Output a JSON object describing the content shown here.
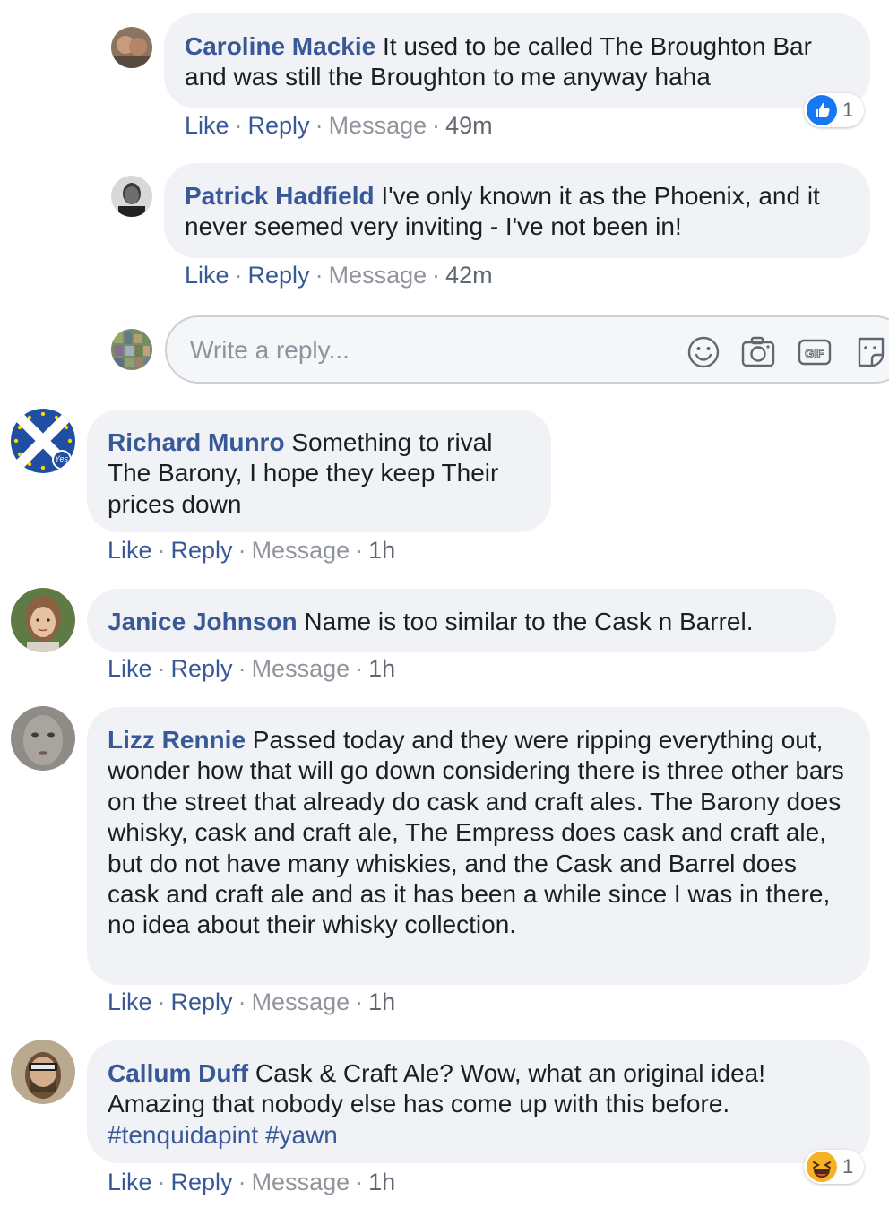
{
  "action_labels": {
    "like": "Like",
    "reply": "Reply",
    "message": "Message",
    "separator": "·"
  },
  "reply_box": {
    "placeholder": "Write a reply...",
    "tools": [
      "smiley-icon",
      "camera-icon",
      "gif-icon",
      "sticker-icon"
    ]
  },
  "replies": [
    {
      "author": "Caroline Mackie",
      "text": "It used to be called The Broughton Bar and was still the Broughton to me anyway haha",
      "time": "49m",
      "reaction": {
        "type": "like",
        "count": "1"
      }
    },
    {
      "author": "Patrick Hadfield",
      "text": "I've only known it as the Phoenix, and it never seemed very inviting - I've not been in!",
      "time": "42m"
    }
  ],
  "comments": [
    {
      "author": "Richard Munro",
      "text": "Something to rival The Barony, I hope they keep Their prices down",
      "time": "1h",
      "avatar_badge": "Yes"
    },
    {
      "author": "Janice Johnson",
      "text": "Name is too similar to the Cask n Barrel.",
      "time": "1h"
    },
    {
      "author": "Lizz Rennie",
      "text": "Passed today and they were ripping everything out, wonder how that will go down considering there is three other bars on the street that already do cask and craft ales. The Barony does whisky, cask and craft ale, The Empress does cask and craft ale, but do not have many whiskies, and the Cask and Barrel does cask and craft ale and as it has been a while since I was in there, no idea about their whisky collection.",
      "time": "1h"
    },
    {
      "author": "Callum Duff",
      "text": "Cask & Craft Ale? Wow, what an original idea! Amazing that nobody else has come up with this before.",
      "hashtags": [
        "#tenquidapint",
        "#yawn"
      ],
      "time": "1h",
      "reaction": {
        "type": "haha",
        "count": "1"
      }
    }
  ],
  "colors": {
    "link": "#385898",
    "bubble": "#f0f2f5",
    "meta": "#90949c",
    "like_blue": "#1877f2",
    "haha_yellow": "#f7b125"
  }
}
